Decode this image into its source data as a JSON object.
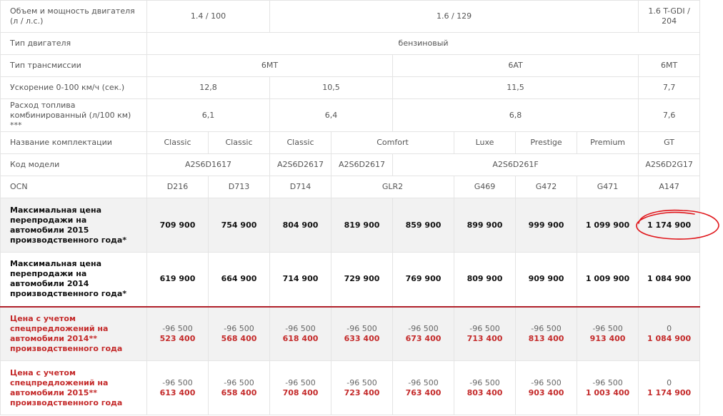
{
  "table": {
    "rows": [
      {
        "label": "Объем и мощность двигателя (л / л.с.)",
        "cells": [
          "1.4 / 100",
          "1.6 / 129",
          "1.6 T-GDI / 204"
        ]
      },
      {
        "label": "Тип двигателя",
        "cells": [
          "бензиновый"
        ]
      },
      {
        "label": "Тип трансмиссии",
        "cells": [
          "6MT",
          "6AT",
          "6MT"
        ]
      },
      {
        "label": "Ускорение 0-100 км/ч (сек.)",
        "cells": [
          "12,8",
          "10,5",
          "11,5",
          "7,7"
        ]
      },
      {
        "label": "Расход топлива комбинированный (л/100 км) ***",
        "cells": [
          "6,1",
          "6,4",
          "6,8",
          "7,6"
        ]
      },
      {
        "label": "Название комплектации",
        "cells": [
          "Classic",
          "Classic",
          "Classic",
          "Comfort",
          "Luxe",
          "Prestige",
          "Premium",
          "GT"
        ]
      },
      {
        "label": "Код модели",
        "cells": [
          "A2S6D1617",
          "A2S6D2617",
          "A2S6D2617",
          "A2S6D261F",
          "A2S6D2G17"
        ]
      },
      {
        "label": "OCN",
        "cells": [
          "D216",
          "D713",
          "D714",
          "GLR2",
          "G469",
          "G472",
          "G471",
          "A147"
        ]
      },
      {
        "label": "Максимальная цена перепродажи на автомобили 2015 производственного года*",
        "cells": [
          "709 900",
          "754 900",
          "804 900",
          "819 900",
          "859 900",
          "899 900",
          "999 900",
          "1 099 900",
          "1 174 900"
        ]
      },
      {
        "label": "Максимальная цена перепродажи на автомобили 2014 производственного года*",
        "cells": [
          "619 900",
          "664 900",
          "714 900",
          "729 900",
          "769 900",
          "809 900",
          "909 900",
          "1 009 900",
          "1 084 900"
        ]
      },
      {
        "label": "Цена с учетом спецпредложений на автомобили 2014** производственного года",
        "discounts": [
          "-96 500",
          "-96 500",
          "-96 500",
          "-96 500",
          "-96 500",
          "-96 500",
          "-96 500",
          "-96 500",
          "0"
        ],
        "prices": [
          "523 400",
          "568 400",
          "618 400",
          "633 400",
          "673 400",
          "713 400",
          "813 400",
          "913 400",
          "1 084 900"
        ]
      },
      {
        "label": "Цена с учетом спецпредложений на автомобили 2015** производственного года",
        "discounts": [
          "-96 500",
          "-96 500",
          "-96 500",
          "-96 500",
          "-96 500",
          "-96 500",
          "-96 500",
          "-96 500",
          "0"
        ],
        "prices": [
          "613 400",
          "658 400",
          "708 400",
          "723 400",
          "763 400",
          "803 400",
          "903 400",
          "1 003 400",
          "1 174 900"
        ]
      }
    ]
  },
  "colors": {
    "accent_red": "#c42a2a",
    "annotation_red": "#e0161b",
    "highlight_bg": "#f2f2f2"
  }
}
